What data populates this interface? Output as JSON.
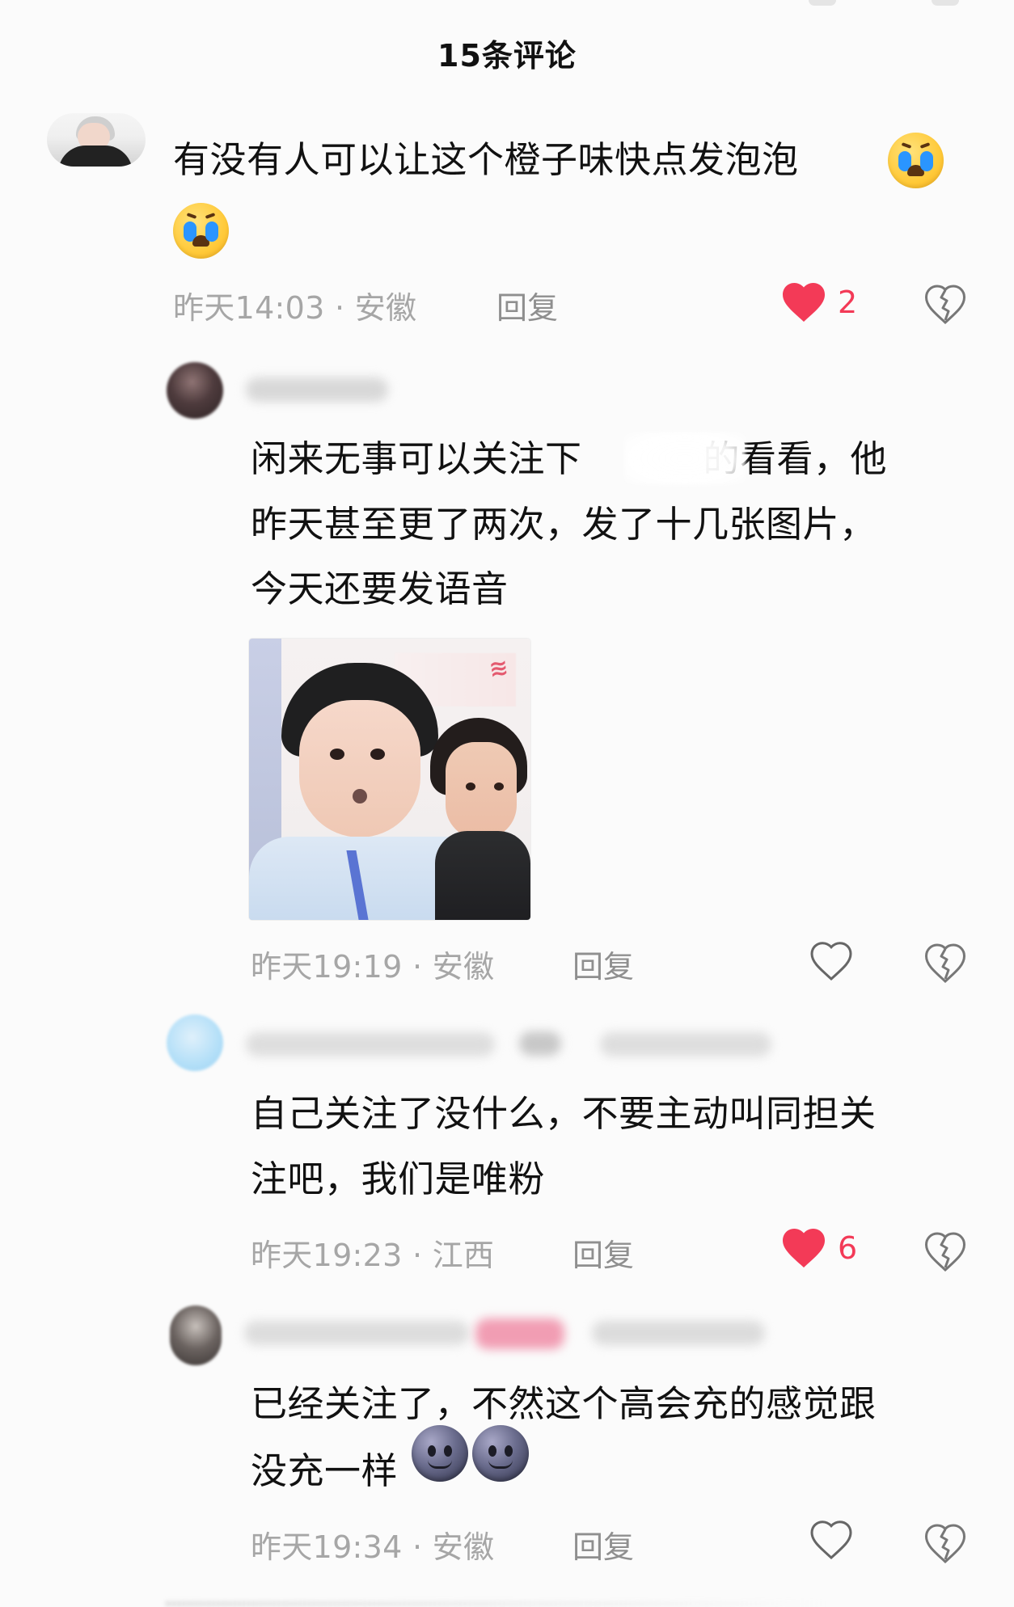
{
  "header": {
    "title": "15条评论"
  },
  "comments": {
    "main": {
      "avatar_alt": "用户头像",
      "text_line1": "有没有人可以让这个橙子味快点发泡泡",
      "meta": "昨天14:03 · 安徽",
      "reply_label": "回复",
      "like_count": "2",
      "liked": true
    },
    "replies": [
      {
        "text_lines": [
          "闲来无事可以关注下",
          "的看看，他",
          "昨天甚至更了两次，发了十几张图片，",
          "今天还要发语音"
        ],
        "meta": "昨天19:19 · 安徽",
        "reply_label": "回复",
        "like_count": "",
        "liked": false
      },
      {
        "text_lines": [
          "自己关注了没什么，不要主动叫同担关",
          "注吧，我们是唯粉"
        ],
        "meta": "昨天19:23 · 江西",
        "reply_label": "回复",
        "like_count": "6",
        "liked": true
      },
      {
        "text_lines": [
          "已经关注了，不然这个高会充的感觉跟",
          "没充一样"
        ],
        "meta": "昨天19:34 · 安徽",
        "reply_label": "回复",
        "like_count": "",
        "liked": false
      }
    ]
  },
  "colors": {
    "background": "#fbfbfb",
    "text": "#111111",
    "meta": "#a6a6a6",
    "reply": "#8f8f8f",
    "liked_heart": "#f33a57",
    "outline_heart": "#6f6f6f"
  },
  "icons": {
    "liked_heart": "heart-filled-icon",
    "unliked_heart": "heart-outline-icon",
    "dislike": "broken-heart-icon",
    "cry_emoji": "loudly-crying-face-icon",
    "moon_emoji": "new-moon-face-icon"
  }
}
